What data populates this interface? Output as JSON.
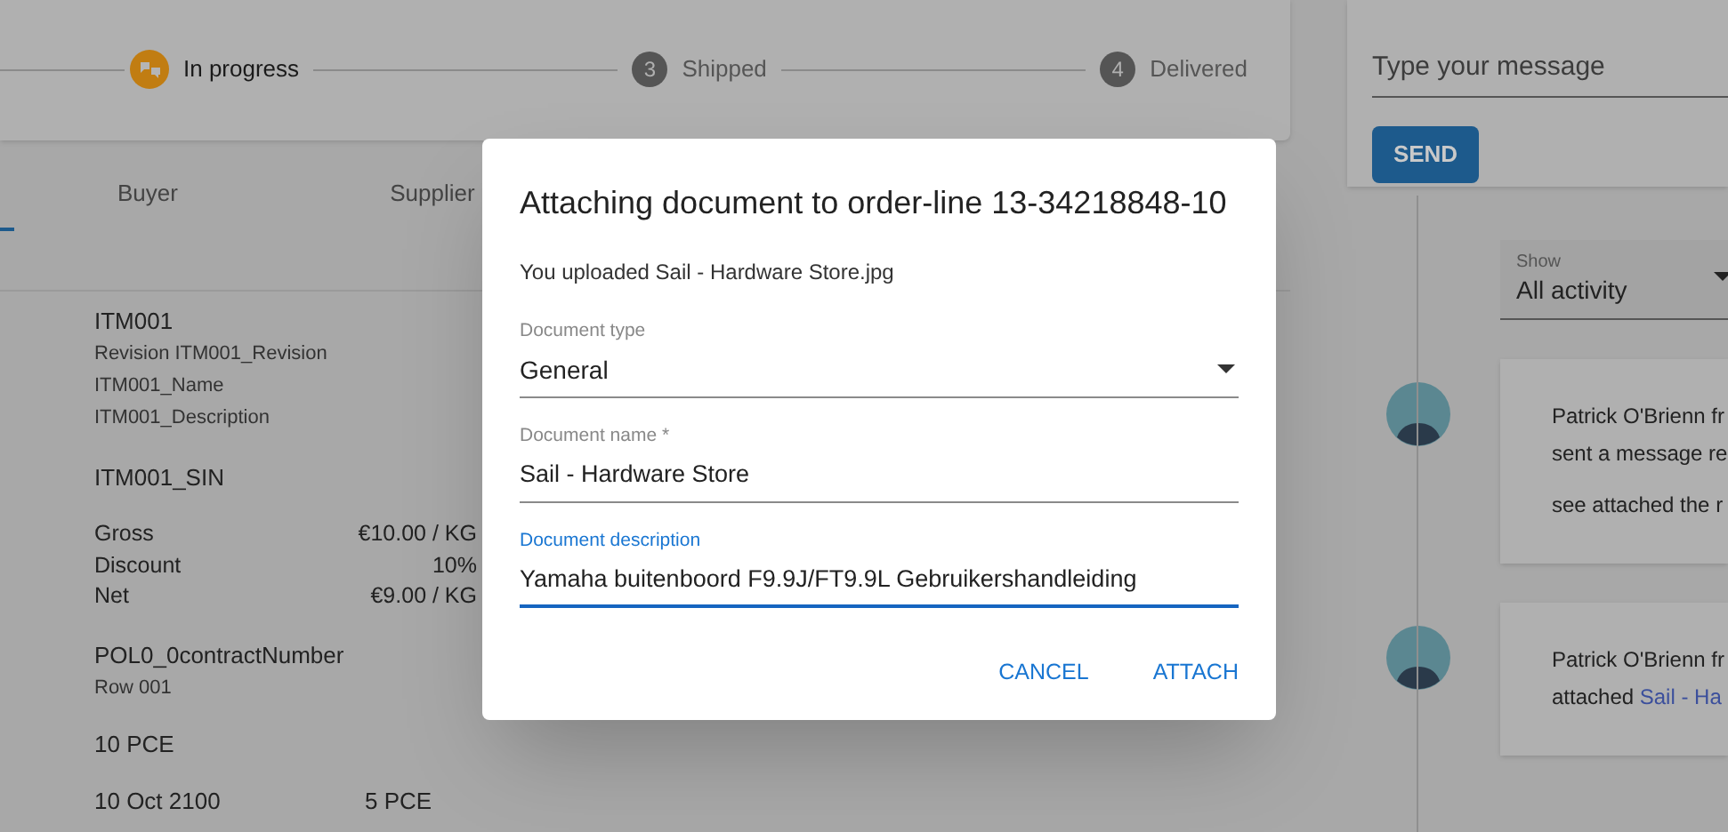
{
  "stepper": [
    {
      "label": "In progress",
      "current": true
    },
    {
      "badge": "3",
      "label": "Shipped",
      "current": false
    },
    {
      "badge": "4",
      "label": "Delivered",
      "current": false
    }
  ],
  "tabs": [
    {
      "selected": true
    },
    {
      "label": "Buyer",
      "selected": false
    },
    {
      "label": "Supplier",
      "selected": false
    }
  ],
  "item": {
    "code": "ITM001",
    "details": [
      "Revision ITM001_Revision",
      "ITM001_Name",
      "ITM001_Description"
    ],
    "sin": "ITM001_SIN",
    "prices": [
      {
        "label": "Gross",
        "value": "€10.00 / KG"
      },
      {
        "label": "Discount",
        "value": "10%"
      },
      {
        "label": "Net",
        "value": "€9.00 / KG"
      }
    ],
    "contract": "POL0_0contractNumber",
    "row": "Row 001",
    "quantity": "10 PCE",
    "deliveries": [
      {
        "date": "10 Oct 2100",
        "quantity": "5 PCE"
      }
    ]
  },
  "message": {
    "placeholder": "Type your message",
    "send": "SEND"
  },
  "filter": {
    "label": "Show",
    "value": "All activity"
  },
  "activity": [
    {
      "lines": [
        "Patrick O'Brienn fr",
        "sent a message re"
      ],
      "body": "see attached the r"
    },
    {
      "lines": [
        "Patrick O'Brienn fr"
      ],
      "prefix": "attached ",
      "link": "Sail - Ha"
    }
  ],
  "dialog": {
    "title": "Attaching document to order-line 13-34218848-10",
    "info": "You uploaded Sail - Hardware Store.jpg",
    "fields": [
      {
        "kind": "select",
        "label": "Document type",
        "value": "General",
        "focused": false
      },
      {
        "kind": "text",
        "label": "Document name *",
        "value": "Sail - Hardware Store",
        "focused": false
      },
      {
        "kind": "text",
        "label": "Document description",
        "value": "Yamaha buitenboord F9.9J/FT9.9L Gebruikershandleiding",
        "focused": true
      }
    ],
    "buttons": [
      "CANCEL",
      "ATTACH"
    ]
  }
}
